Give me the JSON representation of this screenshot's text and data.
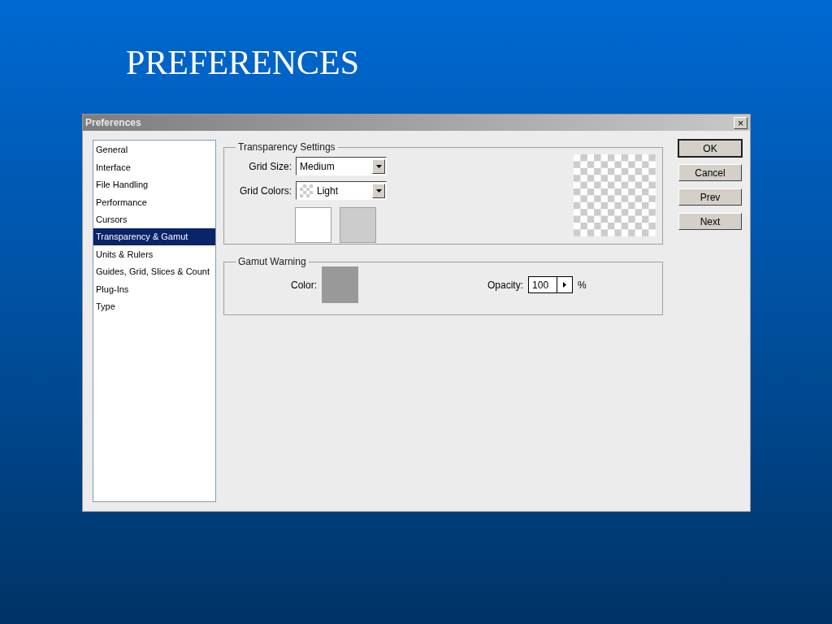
{
  "slide_title": "PREFERENCES",
  "window": {
    "title": "Preferences",
    "close": "×"
  },
  "sidebar": {
    "items": [
      {
        "label": "General",
        "selected": false
      },
      {
        "label": "Interface",
        "selected": false
      },
      {
        "label": "File Handling",
        "selected": false
      },
      {
        "label": "Performance",
        "selected": false
      },
      {
        "label": "Cursors",
        "selected": false
      },
      {
        "label": "Transparency & Gamut",
        "selected": true
      },
      {
        "label": "Units & Rulers",
        "selected": false
      },
      {
        "label": "Guides, Grid, Slices & Count",
        "selected": false
      },
      {
        "label": "Plug-Ins",
        "selected": false
      },
      {
        "label": "Type",
        "selected": false
      }
    ]
  },
  "transparency_settings": {
    "title": "Transparency Settings",
    "grid_size": {
      "label": "Grid Size:",
      "value": "Medium"
    },
    "grid_colors": {
      "label": "Grid Colors:",
      "value": "Light"
    },
    "swatches": [
      {
        "color": "#ffffff"
      },
      {
        "color": "#cccccc"
      }
    ]
  },
  "gamut_warning": {
    "title": "Gamut Warning",
    "color_label": "Color:",
    "color": "#999999",
    "opacity_label": "Opacity:",
    "opacity_value": "100",
    "opacity_unit": "%"
  },
  "buttons": [
    {
      "label": "OK",
      "default": true
    },
    {
      "label": "Cancel",
      "default": false
    },
    {
      "label": "Prev",
      "default": false
    },
    {
      "label": "Next",
      "default": false
    }
  ]
}
